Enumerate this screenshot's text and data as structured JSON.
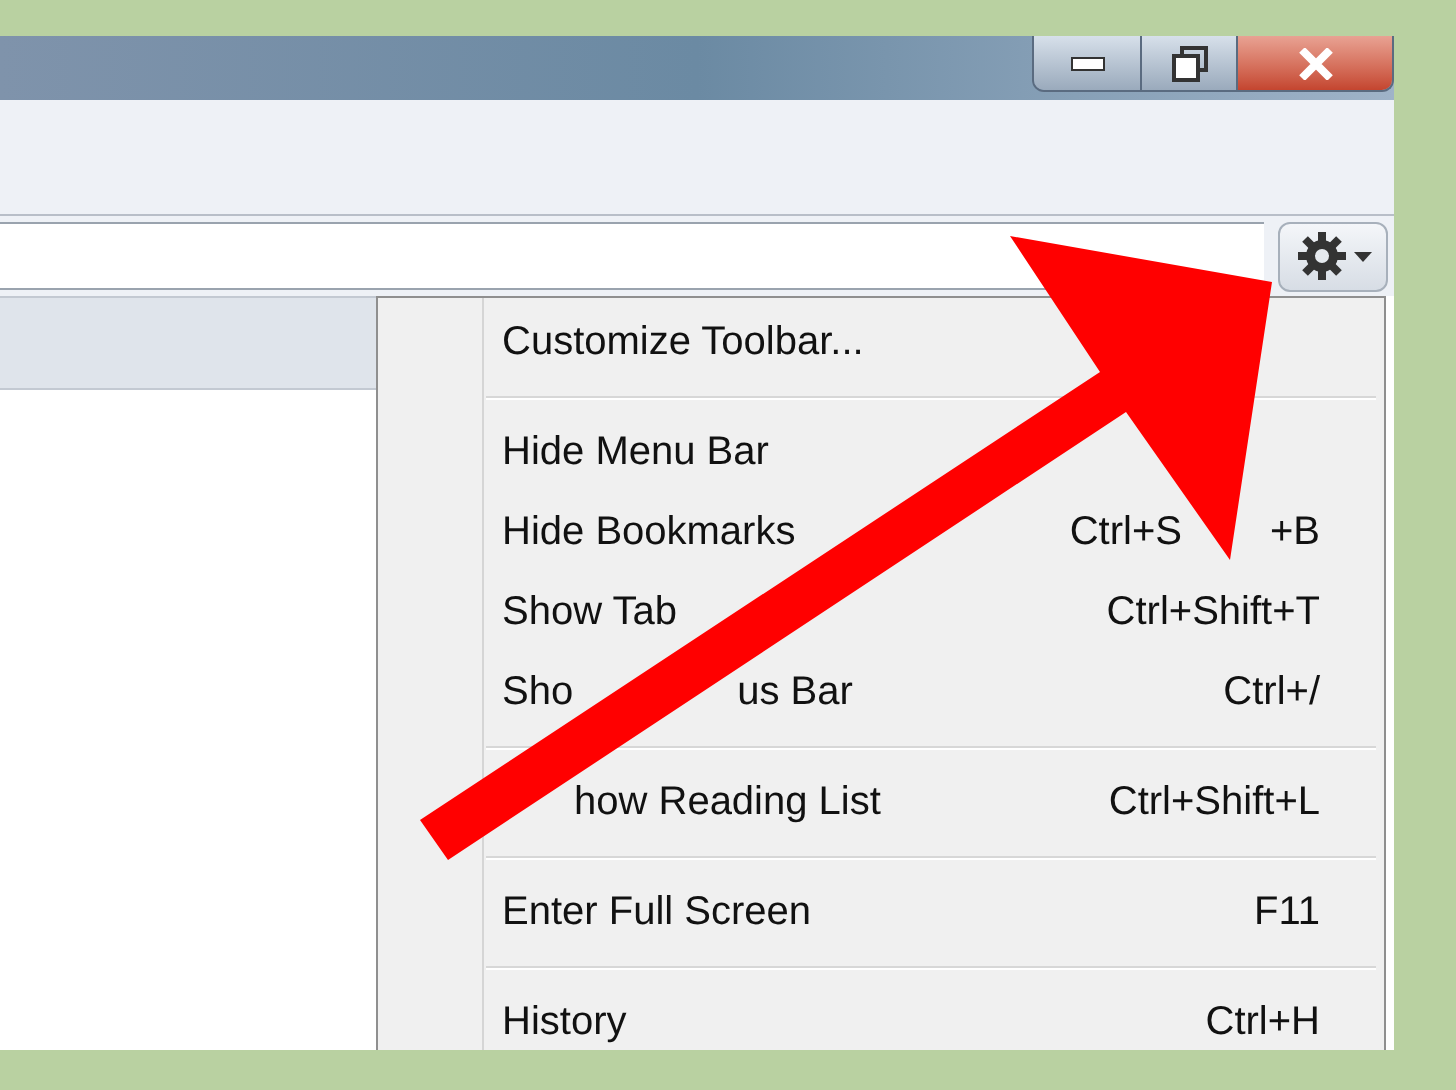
{
  "gear_menu": {
    "items": [
      {
        "kind": "item",
        "label": [
          "Customize Toolbar..."
        ]
      },
      {
        "kind": "separator"
      },
      {
        "kind": "item",
        "label": [
          "Hide Menu Bar"
        ]
      },
      {
        "kind": "item",
        "label": [
          "Hide Bookmarks"
        ],
        "shortcut": [
          "Ctrl+S",
          "+B"
        ],
        "lead_hidden": false
      },
      {
        "kind": "item",
        "label": [
          "Show Tab"
        ],
        "shortcut": [
          "Ctrl+Shift+T"
        ],
        "lead_hidden": false
      },
      {
        "kind": "item",
        "label": [
          "Sho",
          "us Bar"
        ],
        "shortcut": [
          "Ctrl+/"
        ],
        "lead_hidden": false
      },
      {
        "kind": "separator"
      },
      {
        "kind": "item",
        "label": [
          "how Reading List"
        ],
        "shortcut": [
          "Ctrl+Shift+L"
        ],
        "lead_hidden": true
      },
      {
        "kind": "separator"
      },
      {
        "kind": "item",
        "label": [
          "Enter Full Screen"
        ],
        "shortcut": [
          "F11"
        ]
      },
      {
        "kind": "separator"
      },
      {
        "kind": "item",
        "label": [
          "History"
        ],
        "shortcut": [
          "Ctrl+H"
        ]
      }
    ]
  }
}
